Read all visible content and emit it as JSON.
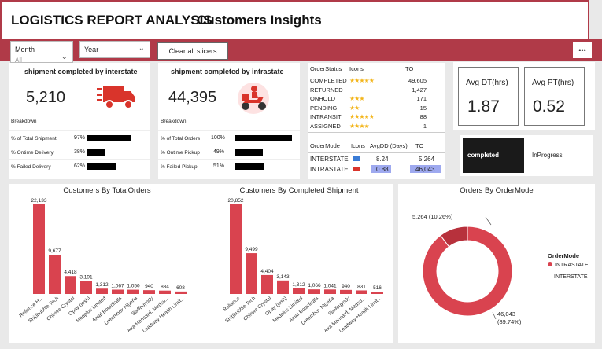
{
  "header": {
    "title": "LOGISTICS REPORT ANALYSIS",
    "subtitle": "Customers Insights"
  },
  "slicers": {
    "month": "Month",
    "month_value": "All",
    "year": "Year",
    "clear": "Clear all slicers",
    "more": "•••"
  },
  "interstate": {
    "title": "shipment completed by interstate",
    "value": "5,210",
    "breakdown": "Breakdown",
    "rows": [
      {
        "label": "% of Total Shipment",
        "pct": "97%",
        "frac": 0.97
      },
      {
        "label": "% Ontime Delivery",
        "pct": "38%",
        "frac": 0.38
      },
      {
        "label": "% Failed Delivery",
        "pct": "62%",
        "frac": 0.62
      }
    ]
  },
  "intrastate": {
    "title": "shipment completed by intrastate",
    "value": "44,395",
    "breakdown": "Breakdown",
    "rows": [
      {
        "label": "% of Total Orders",
        "pct": "100%",
        "frac": 1.0
      },
      {
        "label": "% Ontime Pickup",
        "pct": "49%",
        "frac": 0.49
      },
      {
        "label": "% Failed Pickup",
        "pct": "51%",
        "frac": 0.51
      }
    ]
  },
  "status_table": {
    "headers": [
      "OrderStatus",
      "Icons",
      "TO"
    ],
    "rows": [
      {
        "status": "COMPLETED",
        "stars": 5,
        "to": "49,605"
      },
      {
        "status": "RETURNED",
        "stars": 0,
        "to": "1,427"
      },
      {
        "status": "ONHOLD",
        "stars": 3,
        "to": "171"
      },
      {
        "status": "PENDING",
        "stars": 2,
        "to": "15"
      },
      {
        "status": "INTRANSIT",
        "stars": 5,
        "to": "88"
      },
      {
        "status": "ASSIGNED",
        "stars": 4,
        "to": "1"
      }
    ]
  },
  "mode_table": {
    "headers": [
      "OrderMode",
      "Icons",
      "AvgDD (Days)",
      "TO"
    ],
    "rows": [
      {
        "mode": "INTERSTATE",
        "avg": "8.24",
        "to": "5,264"
      },
      {
        "mode": "INTRASTATE",
        "avg": "0.88",
        "to": "46,043"
      }
    ]
  },
  "avg": {
    "dt_label": "Avg DT(hrs)",
    "dt_value": "1.87",
    "pt_label": "Avg PT(hrs)",
    "pt_value": "0.52"
  },
  "toggle": {
    "completed": "completed",
    "inprogress": "InProgress"
  },
  "colors": {
    "accent": "#b03a48",
    "bar": "#d9434f"
  },
  "chart_data": [
    {
      "type": "bar",
      "title": "Customers By TotalOrders",
      "categories": [
        "Reliance H...",
        "Shipbubble Tech",
        "Chinwe Crystal",
        "Opay (josh)",
        "Medplus Limited",
        "Amal Botanicals",
        "Dreambox Nigeria",
        "9ja9buyndy",
        "Axa Mansard, Medsu...",
        "Leadway Health Limit..."
      ],
      "values": [
        22133,
        9677,
        4418,
        3191,
        1312,
        1067,
        1050,
        940,
        834,
        608
      ],
      "labels": [
        "22,133",
        "9,677",
        "4,418",
        "3,191",
        "1,312",
        "1,067",
        "1,050",
        "940",
        "834",
        "608"
      ]
    },
    {
      "type": "bar",
      "title": "Customers By Completed Shipment",
      "categories": [
        "Reliance",
        "Shipbubble Tech",
        "Chinwe Crystal",
        "Opay (josh)",
        "Medplus Limited",
        "Amal Botanicals",
        "Dreambox Nigeria",
        "9ja9buyndy",
        "Axa Mansard, Medsu...",
        "Leadway Health Limit..."
      ],
      "values": [
        20852,
        9499,
        4404,
        3143,
        1312,
        1066,
        1041,
        940,
        831,
        516
      ],
      "labels": [
        "20,852",
        "9,499",
        "4,404",
        "3,143",
        "1,312",
        "1,066",
        "1,041",
        "940",
        "831",
        "516"
      ]
    },
    {
      "type": "pie",
      "title": "Orders By OrderMode",
      "legend_title": "OrderMode",
      "slices": [
        {
          "name": "INTRASTATE",
          "value": 46043,
          "label": "46,043",
          "pct_label": "(89.74%)"
        },
        {
          "name": "INTERSTATE",
          "value": 5264,
          "label": "5,264 (10.26%)"
        }
      ]
    }
  ]
}
